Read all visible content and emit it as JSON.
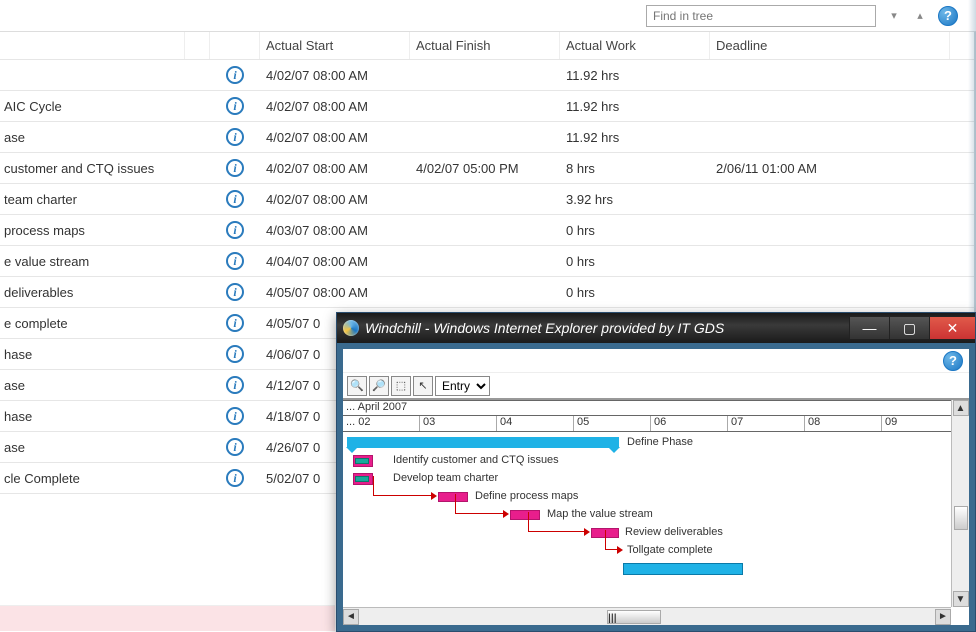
{
  "toolbar": {
    "find_placeholder": "Find in tree"
  },
  "columns": {
    "actual_start": "Actual Start",
    "actual_finish": "Actual Finish",
    "actual_work": "Actual Work",
    "deadline": "Deadline"
  },
  "rows": [
    {
      "name": "",
      "start": "4/02/07 08:00 AM",
      "finish": "",
      "work": "11.92 hrs",
      "deadline": ""
    },
    {
      "name": "AIC Cycle",
      "start": "4/02/07 08:00 AM",
      "finish": "",
      "work": "11.92 hrs",
      "deadline": ""
    },
    {
      "name": "ase",
      "start": "4/02/07 08:00 AM",
      "finish": "",
      "work": "11.92 hrs",
      "deadline": ""
    },
    {
      "name": " customer and CTQ issues",
      "start": "4/02/07 08:00 AM",
      "finish": "4/02/07 05:00 PM",
      "work": "8 hrs",
      "deadline": "2/06/11 01:00 AM"
    },
    {
      "name": " team charter",
      "start": "4/02/07 08:00 AM",
      "finish": "",
      "work": "3.92 hrs",
      "deadline": ""
    },
    {
      "name": "process maps",
      "start": "4/03/07 08:00 AM",
      "finish": "",
      "work": "0 hrs",
      "deadline": ""
    },
    {
      "name": "e value stream",
      "start": "4/04/07 08:00 AM",
      "finish": "",
      "work": "0 hrs",
      "deadline": ""
    },
    {
      "name": " deliverables",
      "start": "4/05/07 08:00 AM",
      "finish": "",
      "work": "0 hrs",
      "deadline": ""
    },
    {
      "name": "e complete",
      "start": "4/05/07 0",
      "finish": "",
      "work": "",
      "deadline": ""
    },
    {
      "name": "hase",
      "start": "4/06/07 0",
      "finish": "",
      "work": "",
      "deadline": ""
    },
    {
      "name": "ase",
      "start": "4/12/07 0",
      "finish": "",
      "work": "",
      "deadline": ""
    },
    {
      "name": "hase",
      "start": "4/18/07 0",
      "finish": "",
      "work": "",
      "deadline": ""
    },
    {
      "name": "ase",
      "start": "4/26/07 0",
      "finish": "",
      "work": "",
      "deadline": ""
    },
    {
      "name": "cle Complete",
      "start": "5/02/07 0",
      "finish": "",
      "work": "",
      "deadline": ""
    }
  ],
  "ie": {
    "title": "Windchill - Windows Internet Explorer provided by IT GDS",
    "toolbar_select": "Entry",
    "month_label": "... April 2007",
    "days": [
      "... 02",
      "03",
      "04",
      "05",
      "06",
      "07",
      "08",
      "09"
    ],
    "tasks": {
      "define_phase": "Define Phase",
      "identify": "Identify customer and CTQ issues",
      "develop": "Develop team charter",
      "processmaps": "Define process maps",
      "valuestream": "Map the value stream",
      "review": "Review deliverables",
      "tollgate": "Tollgate complete"
    }
  }
}
